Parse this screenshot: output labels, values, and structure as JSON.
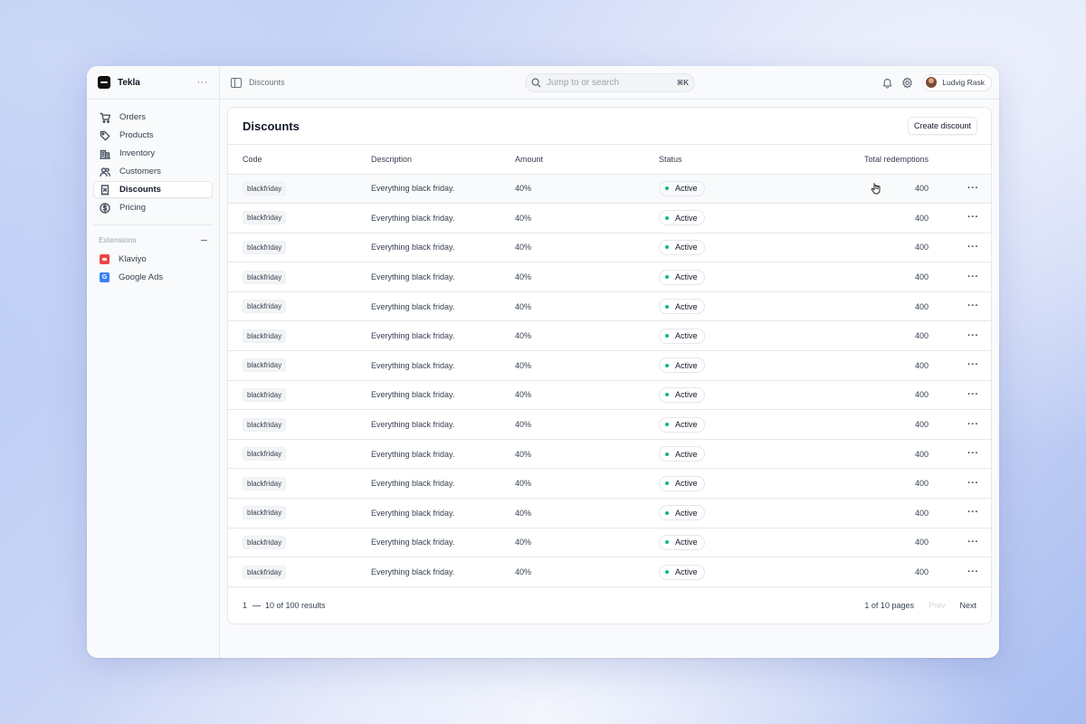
{
  "app": {
    "name": "Tekla"
  },
  "sidebar": {
    "items": [
      {
        "label": "Orders",
        "icon": "cart-icon",
        "active": false
      },
      {
        "label": "Products",
        "icon": "tag-icon",
        "active": false
      },
      {
        "label": "Inventory",
        "icon": "building-icon",
        "active": false
      },
      {
        "label": "Customers",
        "icon": "users-icon",
        "active": false
      },
      {
        "label": "Discounts",
        "icon": "receipt-icon",
        "active": true
      },
      {
        "label": "Pricing",
        "icon": "dollar-circle-icon",
        "active": false
      }
    ],
    "extensions_title": "Extensions",
    "extensions": [
      {
        "label": "Klaviyo",
        "icon": "klaviyo-icon",
        "color": "#ef4444"
      },
      {
        "label": "Google Ads",
        "icon": "google-ads-icon",
        "color": "#3b82f6",
        "glyph": "G"
      }
    ]
  },
  "topbar": {
    "breadcrumb": "Discounts",
    "search_placeholder": "Jump to or search",
    "search_shortcut": "⌘K",
    "user_name": "Ludvig Rask"
  },
  "panel": {
    "title": "Discounts",
    "create_button": "Create discount",
    "columns": [
      "Code",
      "Description",
      "Amount",
      "Status",
      "Total redemptions"
    ],
    "rows": [
      {
        "code": "blackfriday",
        "description": "Everything black friday.",
        "amount": "40%",
        "status": "Active",
        "redemptions": "400"
      },
      {
        "code": "blackfriday",
        "description": "Everything black friday.",
        "amount": "40%",
        "status": "Active",
        "redemptions": "400"
      },
      {
        "code": "blackfriday",
        "description": "Everything black friday.",
        "amount": "40%",
        "status": "Active",
        "redemptions": "400"
      },
      {
        "code": "blackfriday",
        "description": "Everything black friday.",
        "amount": "40%",
        "status": "Active",
        "redemptions": "400"
      },
      {
        "code": "blackfriday",
        "description": "Everything black friday.",
        "amount": "40%",
        "status": "Active",
        "redemptions": "400"
      },
      {
        "code": "blackfriday",
        "description": "Everything black friday.",
        "amount": "40%",
        "status": "Active",
        "redemptions": "400"
      },
      {
        "code": "blackfriday",
        "description": "Everything black friday.",
        "amount": "40%",
        "status": "Active",
        "redemptions": "400"
      },
      {
        "code": "blackfriday",
        "description": "Everything black friday.",
        "amount": "40%",
        "status": "Active",
        "redemptions": "400"
      },
      {
        "code": "blackfriday",
        "description": "Everything black friday.",
        "amount": "40%",
        "status": "Active",
        "redemptions": "400"
      },
      {
        "code": "blackfriday",
        "description": "Everything black friday.",
        "amount": "40%",
        "status": "Active",
        "redemptions": "400"
      },
      {
        "code": "blackfriday",
        "description": "Everything black friday.",
        "amount": "40%",
        "status": "Active",
        "redemptions": "400"
      },
      {
        "code": "blackfriday",
        "description": "Everything black friday.",
        "amount": "40%",
        "status": "Active",
        "redemptions": "400"
      },
      {
        "code": "blackfriday",
        "description": "Everything black friday.",
        "amount": "40%",
        "status": "Active",
        "redemptions": "400"
      },
      {
        "code": "blackfriday",
        "description": "Everything black friday.",
        "amount": "40%",
        "status": "Active",
        "redemptions": "400"
      }
    ],
    "status_color": "#10b981",
    "pagination": {
      "page": "1",
      "results": "10 of 100 results",
      "pages": "1 of 10 pages",
      "prev": "Prev",
      "next": "Next"
    }
  }
}
